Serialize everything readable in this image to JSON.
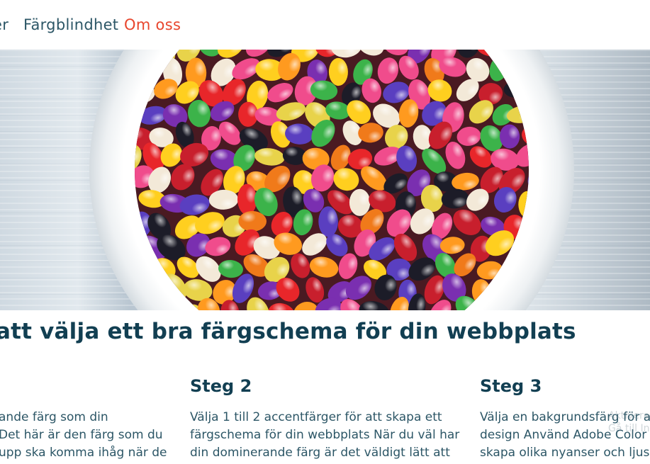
{
  "nav": {
    "items": [
      {
        "label": "er",
        "active": false
      },
      {
        "label": "Färgblindhet",
        "active": false
      },
      {
        "label": "Om oss",
        "active": true
      }
    ],
    "active_color": "#e8462d"
  },
  "hero": {
    "image_description_icon": "jelly-beans-bowl-image"
  },
  "main": {
    "heading": "att välja ett bra färgschema för din webbplats",
    "steps": [
      {
        "title": "",
        "lines": [
          "ande färg som din",
          "Det här är den färg som du",
          "upp ska komma ihåg när de"
        ]
      },
      {
        "title": "Steg 2",
        "lines": [
          "Välja 1 till 2 accentfärger för att skapa ett",
          "färgschema för din webbplats När du väl har",
          "din dominerande färg är det väldigt lätt att"
        ]
      },
      {
        "title": "Steg 3",
        "lines": [
          "Välja en bakgrundsfärg för at",
          "design Använd Adobe Color C",
          "skapa olika nyanser och ljuss"
        ]
      }
    ]
  },
  "watermark": {
    "line1": "Aktivera",
    "line2": "Gå till Inst"
  },
  "colors": {
    "heading": "#123f52",
    "body_text": "#2c5666",
    "accent": "#e8462d"
  }
}
